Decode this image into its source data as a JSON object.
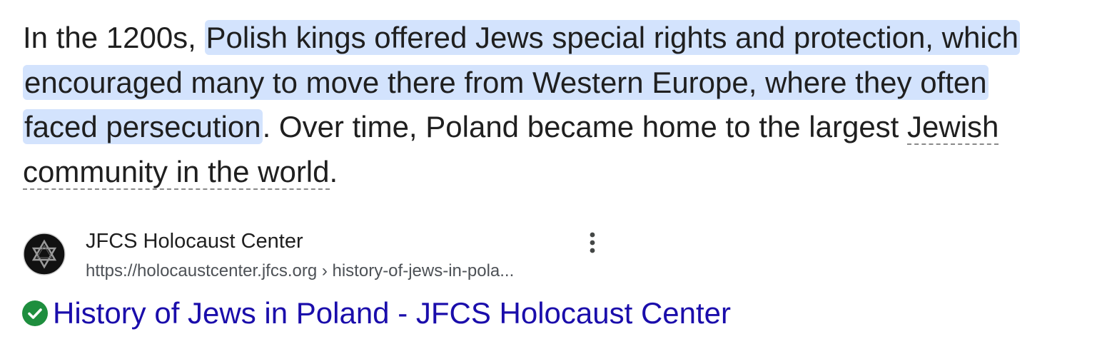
{
  "snippet": {
    "prefix": "In the 1200s, ",
    "highlighted": "Polish kings offered Jews special rights and protection, which encouraged many to move there from Western Europe, where they often faced persecution",
    "middle": ". Over time, Poland became home to the largest ",
    "link_term": "Jewish community in the world",
    "suffix": "."
  },
  "source": {
    "site_name": "JFCS Holocaust Center",
    "url": "https://holocaustcenter.jfcs.org › history-of-jews-in-pola...",
    "favicon_icon": "star-of-david-icon",
    "more_icon": "three-dots-vertical-icon"
  },
  "result": {
    "title": "History of Jews in Poland - JFCS Holocaust Center",
    "verified_icon": "check-circle-icon"
  },
  "colors": {
    "highlight": "#d3e3fd",
    "link": "#1a0dab",
    "verified": "#1e8e3e",
    "text": "#1f1f1f",
    "url_text": "#4d5156"
  }
}
